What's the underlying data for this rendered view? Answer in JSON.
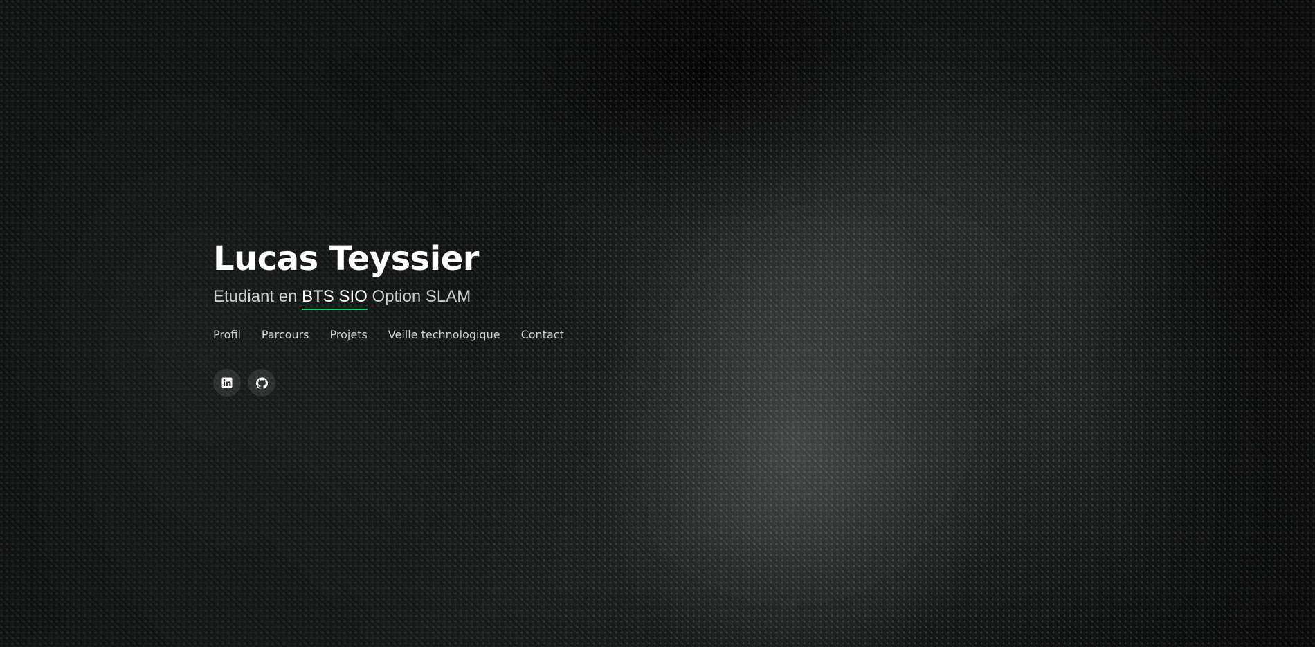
{
  "hero": {
    "name": "Lucas Teyssier",
    "subtitle_prefix": "Etudiant en ",
    "subtitle_highlight": "BTS SIO",
    "subtitle_suffix": " Option SLAM",
    "accent_color": "#18d26e"
  },
  "nav": {
    "items": [
      {
        "label": "Profil"
      },
      {
        "label": "Parcours"
      },
      {
        "label": "Projets"
      },
      {
        "label": "Veille technologique"
      },
      {
        "label": "Contact"
      }
    ]
  },
  "social": {
    "items": [
      {
        "icon": "linkedin-icon"
      },
      {
        "icon": "github-icon"
      }
    ]
  }
}
